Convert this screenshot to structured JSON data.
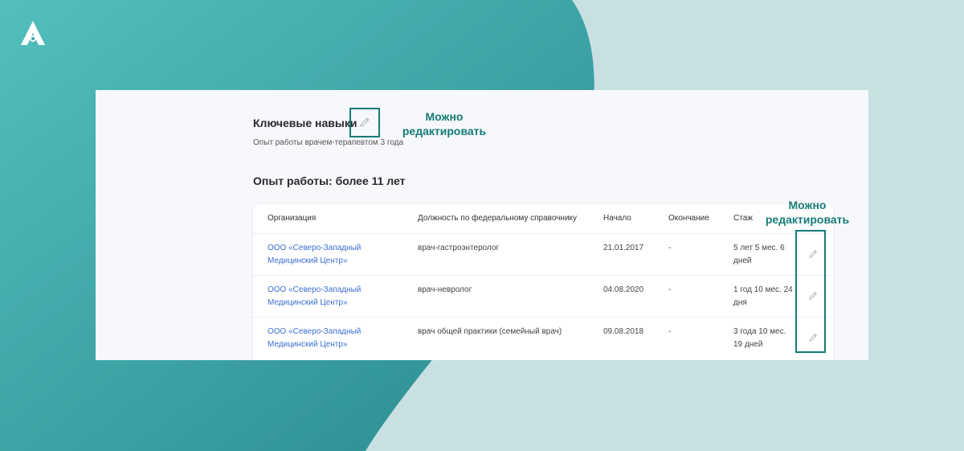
{
  "colors": {
    "accent": "#167a76",
    "link": "#3d6fd0",
    "bg_light": "#c8e0e2",
    "bg_teal_start": "#4fbcbb",
    "bg_teal_end": "#2b8c93"
  },
  "icons": {
    "logo": "logo-icon",
    "edit": "pencil-icon"
  },
  "skills": {
    "title": "Ключевые навыки",
    "description": "Опыт работы врачем-терапевтом 3 года",
    "edit_hint": "Можно\nредактировать"
  },
  "experience": {
    "title": "Опыт работы: более 11 лет",
    "edit_hint": "Можно\nредактировать",
    "columns": [
      "Организация",
      "Должность по федеральному справочнику",
      "Начало",
      "Окончание",
      "Стаж"
    ],
    "rows": [
      {
        "organization": "ООО «Северо-Западный Медицинский Центр»",
        "position": "врач-гастроэнтеролог",
        "start": "21.01.2017",
        "end": "-",
        "experience": "5 лет 5 мес. 6 дней"
      },
      {
        "organization": "ООО «Северо-Западный Медицинский Центр»",
        "position": "врач-невролог",
        "start": "04.08.2020",
        "end": "-",
        "experience": "1 год 10 мес. 24 дня"
      },
      {
        "organization": "ООО «Северо-Западный Медицинский Центр»",
        "position": "врач общей практики (семейный врач)",
        "start": "09.08.2018",
        "end": "-",
        "experience": "3 года 10 мес. 19 дней"
      }
    ]
  }
}
